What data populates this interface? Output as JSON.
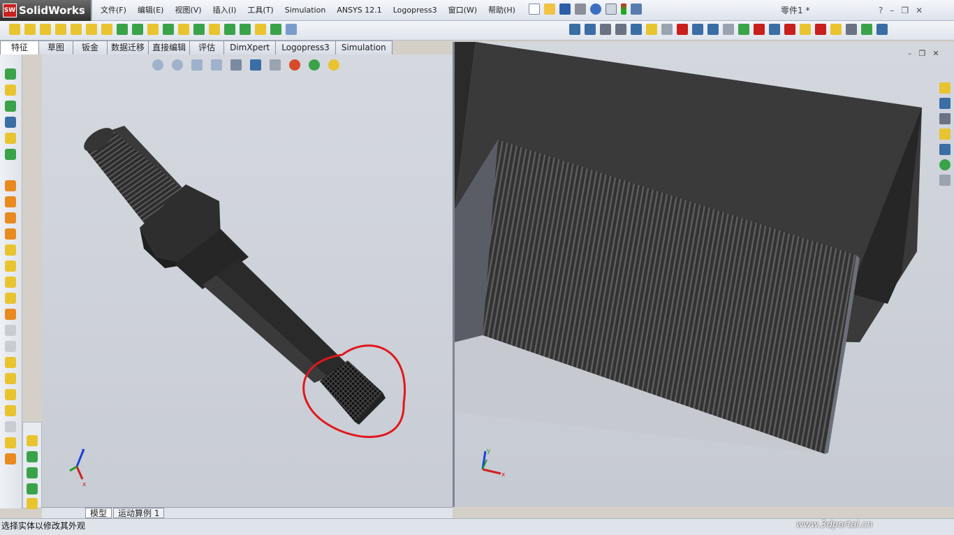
{
  "app": {
    "logo_text": "SolidWorks",
    "logo_badge": "SW"
  },
  "menu": [
    "文件(F)",
    "编辑(E)",
    "视图(V)",
    "插入(I)",
    "工具(T)",
    "Simulation",
    "ANSYS 12.1",
    "Logopress3",
    "窗口(W)",
    "帮助(H)"
  ],
  "document_title": "零件1 *",
  "window_controls": {
    "help": "?",
    "minimize": "–",
    "restore": "❐",
    "close": "✕"
  },
  "tabs": [
    "特征",
    "草图",
    "钣金",
    "数据迁移",
    "直接编辑",
    "评估",
    "DimXpert",
    "Logopress3",
    "Simulation"
  ],
  "active_tab": "特征",
  "bottom_tabs": [
    "模型",
    "运动算例 1"
  ],
  "status_text": "选择实体以修改其外观",
  "watermark": "www.3dportal.cn",
  "triad": {
    "x": "x",
    "y": "y",
    "z": "z"
  },
  "colors": {
    "accent": "#3a6ea5",
    "highlight_circle": "#e0181c",
    "part": "#2b2b2b"
  }
}
